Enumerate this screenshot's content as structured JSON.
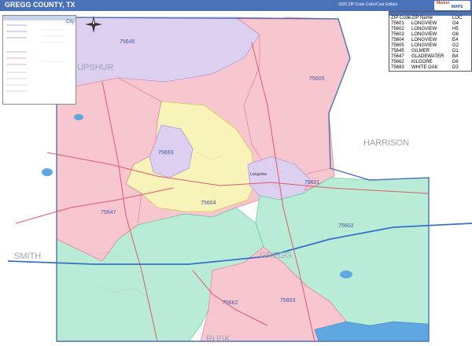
{
  "title": "GREGG COUNTY, TX",
  "edition": "2020 ZIP Code Color/Cast Edition",
  "brand": {
    "a": "Market",
    "b": "MAPS"
  },
  "colors": {
    "pink": "#f7c6cf",
    "green": "#b8ecd6",
    "yellow": "#f8f3b8",
    "lavender": "#dccff0",
    "blue_border": "#4a72b8",
    "road_red": "#e05a6e",
    "interstate": "#3a6fc8"
  },
  "zip_table": {
    "headers": [
      "ZIP Code",
      "ZIP Name",
      "LOC"
    ],
    "rows": [
      [
        "75601",
        "LONGVIEW",
        "G4"
      ],
      [
        "75602",
        "LONGVIEW",
        "H5"
      ],
      [
        "75603",
        "LONGVIEW",
        "G6"
      ],
      [
        "75604",
        "LONGVIEW",
        "E4"
      ],
      [
        "75605",
        "LONGVIEW",
        "G2"
      ],
      [
        "75645",
        "GILMER",
        "D1"
      ],
      [
        "75647",
        "GLADEWATER",
        "B4"
      ],
      [
        "75662",
        "KILGORE",
        "D6"
      ],
      [
        "75693",
        "WHITE OAK",
        "D3"
      ]
    ]
  },
  "zip_labels": [
    "75645",
    "75605",
    "75693",
    "75604",
    "75601",
    "75647",
    "75602",
    "75662",
    "75603"
  ],
  "region_labels": [
    "UPSHUR",
    "HARRISON",
    "SMITH",
    "GREGG",
    "RUSK"
  ],
  "city_label": "Longview",
  "legend": {
    "city_label": "City"
  }
}
